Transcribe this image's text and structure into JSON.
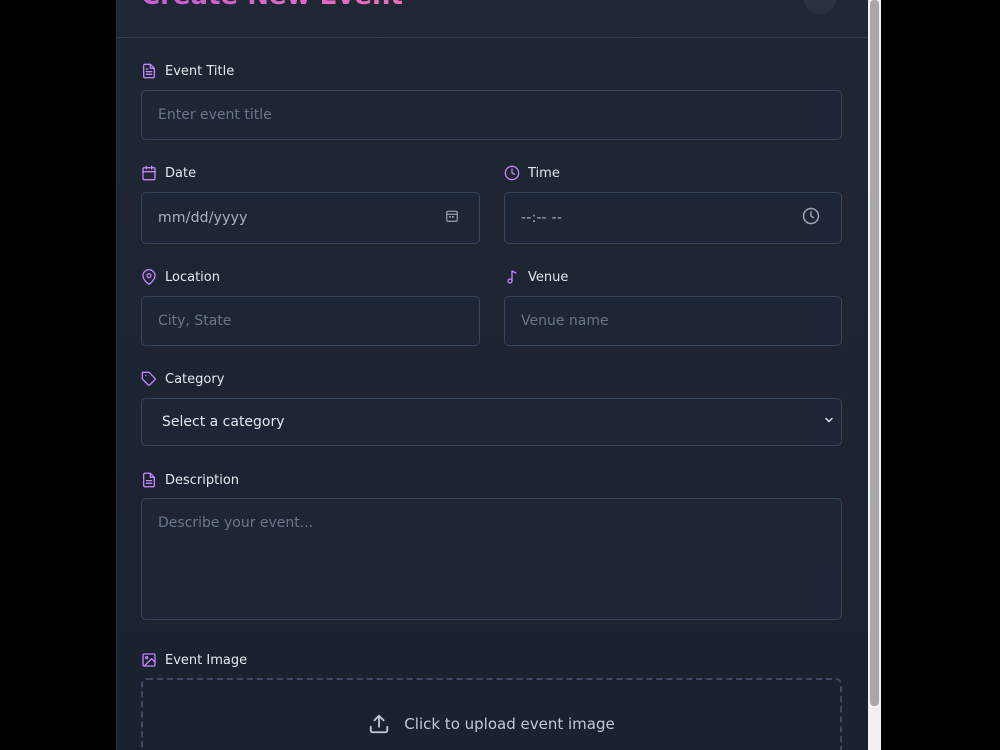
{
  "modal": {
    "title": "Create New Event",
    "close_symbol": "✕"
  },
  "form": {
    "event_title": {
      "label": "Event Title",
      "placeholder": "Enter event title",
      "icon": "document-icon"
    },
    "date": {
      "label": "Date",
      "value_display": "mm/dd/yyyy",
      "icon": "calendar-icon"
    },
    "time": {
      "label": "Time",
      "value_display": "--:-- --",
      "icon": "clock-icon"
    },
    "location": {
      "label": "Location",
      "placeholder": "City, State",
      "icon": "map-pin-icon"
    },
    "venue": {
      "label": "Venue",
      "placeholder": "Venue name",
      "icon": "music-note-icon"
    },
    "category": {
      "label": "Category",
      "selected": "Select a category",
      "icon": "tag-icon"
    },
    "description": {
      "label": "Description",
      "placeholder": "Describe your event...",
      "icon": "document-icon"
    },
    "event_image": {
      "label": "Event Image",
      "upload_text": "Click to upload event image",
      "icon": "image-icon",
      "upload_icon": "upload-icon"
    }
  },
  "colors": {
    "accent": "#c084fc",
    "title_gradient_start": "#c65dd4",
    "title_gradient_end": "#ec6fb8",
    "background": "#1e2533"
  }
}
